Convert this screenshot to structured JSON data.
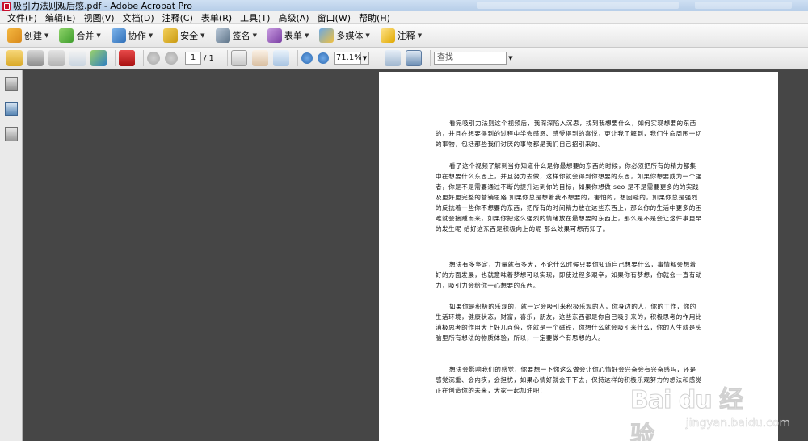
{
  "window": {
    "title": "吸引力法则观后感.pdf - Adobe Acrobat Pro"
  },
  "menu": [
    "文件(F)",
    "编辑(E)",
    "视图(V)",
    "文档(D)",
    "注释(C)",
    "表单(R)",
    "工具(T)",
    "高级(A)",
    "窗口(W)",
    "帮助(H)"
  ],
  "toolbar": {
    "create": "创建",
    "combine": "合并",
    "collaborate": "协作",
    "secure": "安全",
    "sign": "签名",
    "forms": "表单",
    "multimedia": "多媒体",
    "comment": "注释"
  },
  "nav": {
    "current_page": "1",
    "total_pages": "/ 1",
    "zoom": "71.1%",
    "search_placeholder": "查找"
  },
  "document": {
    "paragraphs": [
      "看完吸引力法则这个视频后，我深深陷入沉思，找到我想要什么，如何实现想要的东西的，并且在想要得到的过程中学会感恩、感受得到的喜悦，更让我了解到，我们生命周围一切的事物，包括那些我们讨厌的事物都是我们自己招引来的。",
      "看了这个视频了解到当你知道什么是你最想要的东西的时候，你必须把所有的精力都集中在想要什么东西上，并且努力去做，这样你就会得到你想要的东西，如果你想要成为一个强者，你是不是需要通过不断的提升达到你的目标，如果你想做 seo 是不是需要更多的的实践及更好更完整的营销思路  如果你总是想着我不想要的，害怕的，想回避的，如果你总是强烈的反抗着一些你不想要的东西，把所有的时间精力放在这些东西上，那么你的生活中更多的困难就会接踵而来，如果你把这么强烈的情绪放在最想要的东西上，那么是不是会让这件事更早的发生呢 给好这东西是积极向上的呢 那么效果可想而知了。",
      "想法有多坚定，力量就有多大，不论什么时候只要你知道自己想要什么，事情都会想着好的方面发展，也就意味着梦想可以实现，即使过程多艰辛，如果你有梦想，你就会一直有动力，吸引力会给你一心想要的东西。",
      "如果你是积极的乐观的，就一定会吸引来积极乐观的人，你身边的人，你的工作，你的生活环境，健康状态，财富，喜乐，朋友，这些东西都是你自己吸引来的，积极思考的作用比消极思考的作用大上好几百倍，你就是一个磁铁，你想什么就会吸引来什么，你的人生就是头脑里所有想法的物质体验，所以，一定要做个有思想的人。",
      "想法会影响我们的感觉，你要想一下你这么做会让你心情好会兴奋会有兴奋感吗，还是感觉沉重、会内疚，会担忧，如果心情好就会干下去，保持这样的积极乐观努力的想法和感觉正在创造你的未来，大家一起加油吧！"
    ]
  },
  "watermark": {
    "logo_text": "Bai du 经验",
    "url": "jingyan.baidu.com"
  }
}
